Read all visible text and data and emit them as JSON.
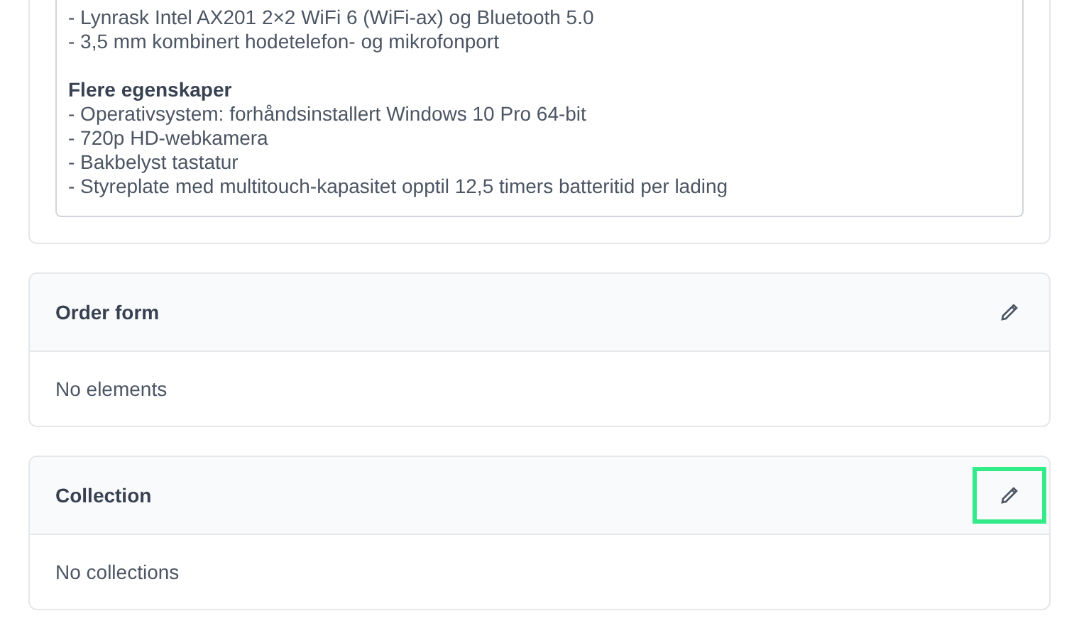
{
  "description": {
    "lines": [
      {
        "kind": "line",
        "text": "- Lynrask Intel AX201 2×2 WiFi 6 (WiFi-ax) og Bluetooth 5.0"
      },
      {
        "kind": "line",
        "text": "- 3,5 mm kombinert hodetelefon- og mikrofonport"
      },
      {
        "kind": "blank"
      },
      {
        "kind": "heading",
        "text": "Flere egenskaper"
      },
      {
        "kind": "line",
        "text": "- Operativsystem: forhåndsinstallert Windows 10 Pro 64-bit"
      },
      {
        "kind": "line",
        "text": "- 720p HD-webkamera"
      },
      {
        "kind": "line",
        "text": "- Bakbelyst tastatur"
      },
      {
        "kind": "line",
        "text": "- Styreplate med multitouch-kapasitet opptil 12,5 timers batteritid per lading"
      }
    ]
  },
  "sections": [
    {
      "title": "Order form",
      "empty_text": "No elements",
      "highlighted": false
    },
    {
      "title": "Collection",
      "empty_text": "No collections",
      "highlighted": true
    }
  ]
}
